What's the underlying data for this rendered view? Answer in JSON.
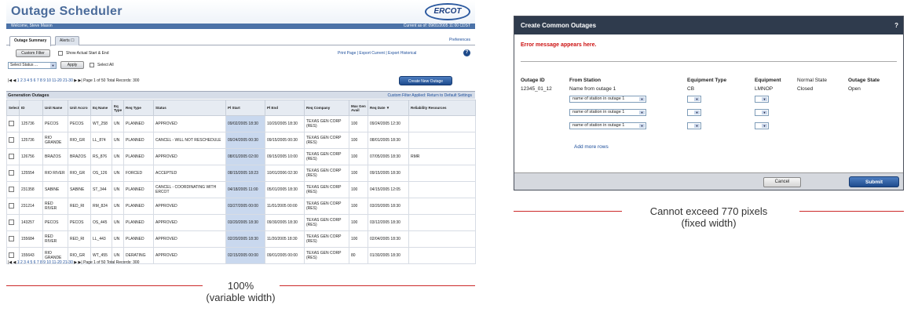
{
  "left": {
    "app_title": "Outage Scheduler",
    "logo": "ERCOT",
    "welcome": "Welcome, Steve Mason",
    "current_as_of": "Current as of: 09/01/2005 11:00 CDST",
    "tabs": [
      "Outage Summary",
      "Alerts"
    ],
    "preferences": "Preferences",
    "custom_filter": "Custom Filter",
    "show_actual": "Show Actual Start & End",
    "print_links": "Print Page  |  Export Current  |  Export Historical",
    "status_select": "Select Status ...",
    "apply": "Apply",
    "select_all": "Select All",
    "create_new": "Create New Outage",
    "pager_pages": "1  2  3  4  5  6  7  8  9  10  11-20  21-30",
    "pager_info": "Page 1 of 50   Total Records: 300",
    "section_title": "Generation Outages",
    "section_right": "Custom Filter Applied: Return to Default Settings",
    "columns": [
      "Select",
      "ID",
      "Unit Name",
      "Unit Accro",
      "Eq Name",
      "Eq Type",
      "Req Type",
      "Status",
      "Pl Start",
      "Pl End",
      "Req Company",
      "Max Gen Avail",
      "Req Date ▼",
      "Reliability Resources"
    ],
    "rows": [
      [
        "",
        "125736",
        "PECOS",
        "PECOS",
        "WT_258",
        "UN",
        "PLANNED",
        "APPROVED",
        "09/02/2005 18:30",
        "10/20/2005 18:30",
        "TEXAS GEN CORP (RES)",
        "100",
        "09/24/2005 12:30",
        ""
      ],
      [
        "",
        "125736",
        "RIO GRANDE",
        "RIO_GR",
        "LL_874",
        "UN",
        "PLANNED",
        "CANCEL - WILL NOT RESCHEDULE",
        "09/24/2005 00:30",
        "09/15/2005 00:30",
        "TEXAS GEN CORP (RES)",
        "100",
        "08/01/2005 18:30",
        ""
      ],
      [
        "",
        "126756",
        "BRAZOS",
        "BRAZOS",
        "RS_876",
        "UN",
        "PLANNED",
        "APPROVED",
        "08/01/2005 02:00",
        "09/15/2005 10:00",
        "TEXAS GEN CORP (RES)",
        "100",
        "07/05/2005 18:30",
        "RMR"
      ],
      [
        "",
        "125554",
        "RIO RIVER",
        "RIO_GR",
        "OS_126",
        "UN",
        "FORCED",
        "ACCEPTED",
        "08/15/2005 18:23",
        "10/01/2006 02:30",
        "TEXAS GEN CORP (RES)",
        "100",
        "09/15/2005 18:30",
        ""
      ],
      [
        "",
        "231358",
        "SABINE",
        "SABINE",
        "ST_344",
        "UN",
        "PLANNED",
        "CANCEL - COORDINATING WITH ERCOT",
        "04/18/2005 11:00",
        "05/01/2005 18:30",
        "TEXAS GEN CORP (RES)",
        "100",
        "04/15/2005 12:05",
        ""
      ],
      [
        "",
        "231214",
        "RED RIVER",
        "RED_RI",
        "RM_824",
        "UN",
        "PLANNED",
        "APPROVED",
        "03/27/2005 00:00",
        "11/01/2005 00:00",
        "TEXAS GEN CORP (RES)",
        "100",
        "03/20/2005 18:30",
        ""
      ],
      [
        "",
        "143257",
        "PECOS",
        "PECOS",
        "OS_445",
        "UN",
        "PLANNED",
        "APPROVED",
        "03/20/2005 18:30",
        "09/30/2005 18:30",
        "TEXAS GEN CORP (RES)",
        "100",
        "03/12/2005 18:30",
        ""
      ],
      [
        "",
        "155684",
        "RED RIVER",
        "RED_RI",
        "LL_443",
        "UN",
        "PLANNED",
        "APPROVED",
        "02/20/2005 18:30",
        "11/20/2005 18:30",
        "TEXAS GEN CORP (RES)",
        "100",
        "02/04/2005 18:30",
        ""
      ],
      [
        "",
        "155643",
        "RIO GRANDE",
        "RIO_GR",
        "WT_455",
        "UN",
        "DERATING",
        "APPROVED",
        "02/15/2005 00:00",
        "09/01/2005 00:00",
        "TEXAS GEN CORP (RES)",
        "80",
        "01/30/2005 18:30",
        ""
      ]
    ],
    "caption_pct": "100%",
    "caption_sub": "(variable width)"
  },
  "right": {
    "title": "Create Common Outages",
    "error": "Error message appears here.",
    "headers": {
      "outage_id": "Outage ID",
      "from_station": "From Station",
      "equipment_type": "Equipment Type",
      "equipment": "Equipment",
      "normal_state": "Normal State",
      "outage_state": "Outage State"
    },
    "first_row": {
      "outage_id": "12345_01_12",
      "from_station": "Name from outage 1",
      "equipment_type": "CB",
      "equipment": "LMNOP",
      "normal_state": "Closed",
      "outage_state": "Open"
    },
    "station_select": "name of station in outage 1",
    "add_more_rows": "Add more rows",
    "cancel": "Cancel",
    "submit": "Submit",
    "caption_main": "Cannot exceed 770 pixels",
    "caption_sub": "(fixed width)"
  }
}
